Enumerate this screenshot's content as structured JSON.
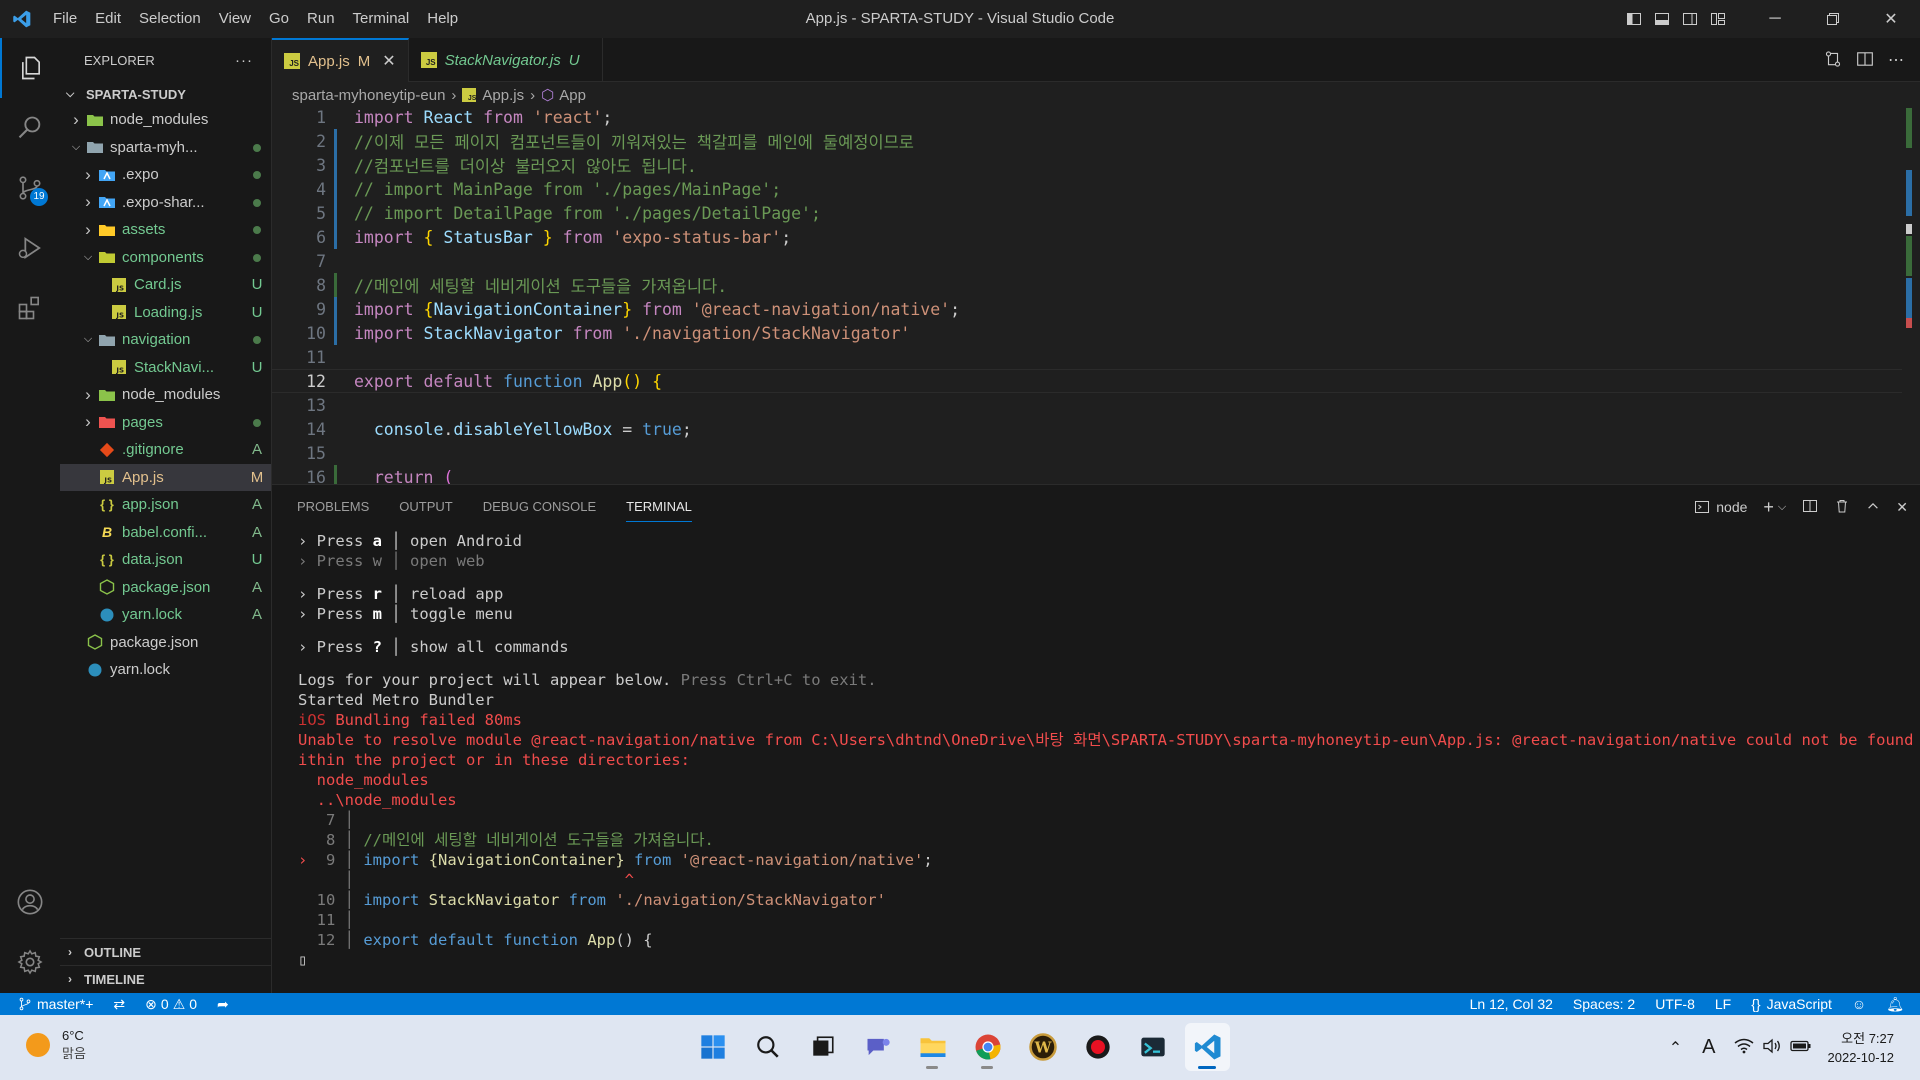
{
  "titlebar": {
    "menus": [
      "File",
      "Edit",
      "Selection",
      "View",
      "Go",
      "Run",
      "Terminal",
      "Help"
    ],
    "title": "App.js - SPARTA-STUDY - Visual Studio Code"
  },
  "activitybar": {
    "scm_badge": "19"
  },
  "sidebar": {
    "header": "EXPLORER",
    "more": "···",
    "root": "SPARTA-STUDY",
    "tree": [
      {
        "name": "node_modules",
        "icon": "folder-node-icon",
        "expand": ">",
        "status": "",
        "color": "c-default",
        "statcls": ""
      },
      {
        "name": "sparta-myh...",
        "icon": "folder-icon",
        "expand": "v",
        "status": "dot",
        "color": "c-default",
        "statcls": ""
      },
      {
        "name": ".expo",
        "icon": "folder-expo-icon",
        "expand": ">",
        "status": "dot",
        "color": "c-default",
        "statcls": ""
      },
      {
        "name": ".expo-shar...",
        "icon": "folder-expo-icon",
        "expand": ">",
        "status": "dot",
        "color": "c-default",
        "statcls": ""
      },
      {
        "name": "assets",
        "icon": "folder-assets-icon",
        "expand": ">",
        "status": "dot",
        "color": "c-green",
        "statcls": ""
      },
      {
        "name": "components",
        "icon": "folder-components-icon",
        "expand": "v",
        "status": "dot",
        "color": "c-green",
        "statcls": ""
      },
      {
        "name": "Card.js",
        "icon": "js-file-icon",
        "expand": "",
        "status": "U",
        "color": "c-green",
        "statcls": "c-untracked"
      },
      {
        "name": "Loading.js",
        "icon": "js-file-icon",
        "expand": "",
        "status": "U",
        "color": "c-green",
        "statcls": "c-untracked"
      },
      {
        "name": "navigation",
        "icon": "folder-icon",
        "expand": "v",
        "status": "dot",
        "color": "c-green",
        "statcls": ""
      },
      {
        "name": "StackNavi...",
        "icon": "js-file-icon",
        "expand": "",
        "status": "U",
        "color": "c-green",
        "statcls": "c-untracked"
      },
      {
        "name": "node_modules",
        "icon": "folder-node-icon",
        "expand": ">",
        "status": "",
        "color": "c-default",
        "statcls": ""
      },
      {
        "name": "pages",
        "icon": "folder-pages-icon",
        "expand": ">",
        "status": "dot",
        "color": "c-green",
        "statcls": ""
      },
      {
        "name": ".gitignore",
        "icon": "git-file-icon",
        "expand": "",
        "status": "A",
        "color": "c-green",
        "statcls": "c-added"
      },
      {
        "name": "App.js",
        "icon": "js-file-icon",
        "expand": "",
        "status": "M",
        "color": "c-modified",
        "statcls": "c-modified"
      },
      {
        "name": "app.json",
        "icon": "json-file-icon",
        "expand": "",
        "status": "A",
        "color": "c-green",
        "statcls": "c-added"
      },
      {
        "name": "babel.confi...",
        "icon": "babel-file-icon",
        "expand": "",
        "status": "A",
        "color": "c-green",
        "statcls": "c-added"
      },
      {
        "name": "data.json",
        "icon": "json-file-icon",
        "expand": "",
        "status": "U",
        "color": "c-green",
        "statcls": "c-untracked"
      },
      {
        "name": "package.json",
        "icon": "npm-file-icon",
        "expand": "",
        "status": "A",
        "color": "c-green",
        "statcls": "c-added"
      },
      {
        "name": "yarn.lock",
        "icon": "yarn-file-icon",
        "expand": "",
        "status": "A",
        "color": "c-green",
        "statcls": "c-added"
      },
      {
        "name": "package.json",
        "icon": "npm-file-icon",
        "expand": "",
        "status": "",
        "color": "c-default",
        "statcls": ""
      },
      {
        "name": "yarn.lock",
        "icon": "yarn-file-icon",
        "expand": "",
        "status": "",
        "color": "c-default",
        "statcls": ""
      }
    ],
    "outline": "OUTLINE",
    "timeline": "TIMELINE"
  },
  "tabs": [
    {
      "label": "App.js",
      "status": "M",
      "close": "✕",
      "active": true
    },
    {
      "label": "StackNavigator.js",
      "status": "U",
      "active": false
    }
  ],
  "breadcrumb": {
    "folder": "sparta-myhoneytip-eun",
    "file": "App.js",
    "symbol": "App"
  },
  "editor": {
    "current_line": 12,
    "lines": [
      {
        "n": 1,
        "tokens": [
          [
            "kw",
            "import"
          ],
          [
            "t",
            " "
          ],
          [
            "var",
            "React"
          ],
          [
            "t",
            " "
          ],
          [
            "kw",
            "from"
          ],
          [
            "t",
            " "
          ],
          [
            "str",
            "'react'"
          ],
          [
            "t",
            ";"
          ]
        ]
      },
      {
        "n": 2,
        "tokens": [
          [
            "cm",
            "//이제 모든 페이지 컴포넌트들이 끼워져있는 책갈피를 메인에 둘예정이므로"
          ]
        ]
      },
      {
        "n": 3,
        "tokens": [
          [
            "cm",
            "//컴포넌트를 더이상 불러오지 않아도 됩니다."
          ]
        ]
      },
      {
        "n": 4,
        "tokens": [
          [
            "cm",
            "// import MainPage from './pages/MainPage';"
          ]
        ]
      },
      {
        "n": 5,
        "tokens": [
          [
            "cm",
            "// import DetailPage from './pages/DetailPage';"
          ]
        ]
      },
      {
        "n": 6,
        "tokens": [
          [
            "kw",
            "import"
          ],
          [
            "t",
            " "
          ],
          [
            "br",
            "{"
          ],
          [
            "t",
            " "
          ],
          [
            "var",
            "StatusBar"
          ],
          [
            "t",
            " "
          ],
          [
            "br",
            "}"
          ],
          [
            "t",
            " "
          ],
          [
            "kw",
            "from"
          ],
          [
            "t",
            " "
          ],
          [
            "str",
            "'expo-status-bar'"
          ],
          [
            "t",
            ";"
          ]
        ]
      },
      {
        "n": 7,
        "tokens": []
      },
      {
        "n": 8,
        "tokens": [
          [
            "cm",
            "//메인에 세팅할 네비게이션 도구들을 가져옵니다."
          ]
        ]
      },
      {
        "n": 9,
        "tokens": [
          [
            "kw",
            "import"
          ],
          [
            "t",
            " "
          ],
          [
            "br",
            "{"
          ],
          [
            "var",
            "NavigationContainer"
          ],
          [
            "br",
            "}"
          ],
          [
            "t",
            " "
          ],
          [
            "kw",
            "from"
          ],
          [
            "t",
            " "
          ],
          [
            "str",
            "'@react-navigation/native'"
          ],
          [
            "t",
            ";"
          ]
        ]
      },
      {
        "n": 10,
        "tokens": [
          [
            "kw",
            "import"
          ],
          [
            "t",
            " "
          ],
          [
            "var",
            "StackNavigator"
          ],
          [
            "t",
            " "
          ],
          [
            "kw",
            "from"
          ],
          [
            "t",
            " "
          ],
          [
            "str",
            "'./navigation/StackNavigator'"
          ]
        ]
      },
      {
        "n": 11,
        "tokens": []
      },
      {
        "n": 12,
        "tokens": [
          [
            "kw",
            "export"
          ],
          [
            "t",
            " "
          ],
          [
            "kw",
            "default"
          ],
          [
            "t",
            " "
          ],
          [
            "kw2",
            "function"
          ],
          [
            "t",
            " "
          ],
          [
            "fn",
            "App"
          ],
          [
            "br",
            "()"
          ],
          [
            "t",
            " "
          ],
          [
            "br",
            "{"
          ]
        ]
      },
      {
        "n": 13,
        "tokens": []
      },
      {
        "n": 14,
        "tokens": [
          [
            "t",
            "  "
          ],
          [
            "var",
            "console"
          ],
          [
            "t",
            "."
          ],
          [
            "var",
            "disableYellowBox"
          ],
          [
            "t",
            " = "
          ],
          [
            "kw2",
            "true"
          ],
          [
            "t",
            ";"
          ]
        ]
      },
      {
        "n": 15,
        "tokens": []
      },
      {
        "n": 16,
        "tokens": [
          [
            "t",
            "  "
          ],
          [
            "kw",
            "return"
          ],
          [
            "t",
            " "
          ],
          [
            "br2",
            "("
          ]
        ]
      }
    ]
  },
  "panel": {
    "tabs": [
      "PROBLEMS",
      "OUTPUT",
      "DEBUG CONSOLE",
      "TERMINAL"
    ],
    "active_tab": "TERMINAL",
    "terminal_name": "node",
    "terminal": [
      {
        "cls": "",
        "segs": [
          [
            "",
            "› Press "
          ],
          [
            "t-bold",
            "a"
          ],
          [
            "",
            " │ open Android"
          ]
        ]
      },
      {
        "cls": "t-dim",
        "segs": [
          [
            "t-dim",
            "› Press w │ open web"
          ]
        ]
      },
      {
        "cls": "",
        "segs": [
          [
            "",
            ""
          ]
        ]
      },
      {
        "cls": "",
        "segs": [
          [
            "",
            "› Press "
          ],
          [
            "t-bold",
            "r"
          ],
          [
            "",
            " │ reload app"
          ]
        ]
      },
      {
        "cls": "",
        "segs": [
          [
            "",
            "› Press "
          ],
          [
            "t-bold",
            "m"
          ],
          [
            "",
            " │ toggle menu"
          ]
        ]
      },
      {
        "cls": "",
        "segs": [
          [
            "",
            ""
          ]
        ]
      },
      {
        "cls": "",
        "segs": [
          [
            "",
            "› Press "
          ],
          [
            "t-bold",
            "?"
          ],
          [
            "",
            " │ show all commands"
          ]
        ]
      },
      {
        "cls": "",
        "segs": [
          [
            "",
            ""
          ]
        ]
      },
      {
        "cls": "",
        "segs": [
          [
            "",
            "Logs for your project will appear below. "
          ],
          [
            "t-dim",
            "Press Ctrl+C to exit."
          ]
        ]
      },
      {
        "cls": "",
        "segs": [
          [
            "",
            "Started Metro Bundler"
          ]
        ]
      },
      {
        "cls": "",
        "segs": [
          [
            "t-err2",
            "iOS"
          ],
          [
            "t-err",
            " Bundling failed 80ms"
          ]
        ]
      },
      {
        "cls": "",
        "segs": [
          [
            "t-err",
            "Unable to resolve module @react-navigation/native from C:\\Users\\dhtnd\\OneDrive\\바탕 화면\\SPARTA-STUDY\\sparta-myhoneytip-eun\\App.js: @react-navigation/native could not be found w"
          ]
        ]
      },
      {
        "cls": "",
        "segs": [
          [
            "t-err",
            "ithin the project or in these directories:"
          ]
        ]
      },
      {
        "cls": "",
        "segs": [
          [
            "t-err",
            "  node_modules"
          ]
        ]
      },
      {
        "cls": "",
        "segs": [
          [
            "t-err",
            "  ..\\node_modules"
          ]
        ]
      },
      {
        "cls": "",
        "segs": [
          [
            "t-dim",
            "   7 │"
          ]
        ]
      },
      {
        "cls": "",
        "segs": [
          [
            "t-dim",
            "   8 │ "
          ],
          [
            "tk-cm",
            "//메인에 세팅할 네비게이션 도구들을 가져옵니다."
          ]
        ]
      },
      {
        "cls": "",
        "segs": [
          [
            "t-err",
            "›"
          ],
          [
            "t-dim",
            "  9 │ "
          ],
          [
            "tk-kw2",
            "import"
          ],
          [
            "",
            " "
          ],
          [
            "tk-fn",
            "{NavigationContainer}"
          ],
          [
            "",
            " "
          ],
          [
            "tk-kw2",
            "from"
          ],
          [
            "",
            " "
          ],
          [
            "tk-str",
            "'@react-navigation/native'"
          ],
          [
            "",
            ";"
          ]
        ]
      },
      {
        "cls": "",
        "segs": [
          [
            "t-dim",
            "     │                             "
          ],
          [
            "t-err",
            "^"
          ]
        ]
      },
      {
        "cls": "",
        "segs": [
          [
            "t-dim",
            "  10 │ "
          ],
          [
            "tk-kw2",
            "import"
          ],
          [
            "",
            " "
          ],
          [
            "tk-fn",
            "StackNavigator"
          ],
          [
            "",
            " "
          ],
          [
            "tk-kw2",
            "from"
          ],
          [
            "",
            " "
          ],
          [
            "tk-str",
            "'./navigation/StackNavigator'"
          ]
        ]
      },
      {
        "cls": "",
        "segs": [
          [
            "t-dim",
            "  11 │"
          ]
        ]
      },
      {
        "cls": "",
        "segs": [
          [
            "t-dim",
            "  12 │ "
          ],
          [
            "tk-kw2",
            "export default function"
          ],
          [
            "",
            " "
          ],
          [
            "tk-fn",
            "App"
          ],
          [
            "",
            "() {"
          ]
        ]
      },
      {
        "cls": "",
        "segs": [
          [
            "",
            "▯"
          ]
        ]
      }
    ]
  },
  "statusbar": {
    "branch": "master*+",
    "errors": "0",
    "warnings": "0",
    "position": "Ln 12, Col 32",
    "spaces": "Spaces: 2",
    "encoding": "UTF-8",
    "eol": "LF",
    "language": "JavaScript"
  },
  "taskbar": {
    "temp": "6°C",
    "weather": "맑음",
    "time": "오전 7:27",
    "date": "2022-10-12",
    "ime": "A"
  },
  "colors": {
    "accent": "#0078d4",
    "statusbar": "#0078d4",
    "editor_bg": "#1f1f1f"
  }
}
